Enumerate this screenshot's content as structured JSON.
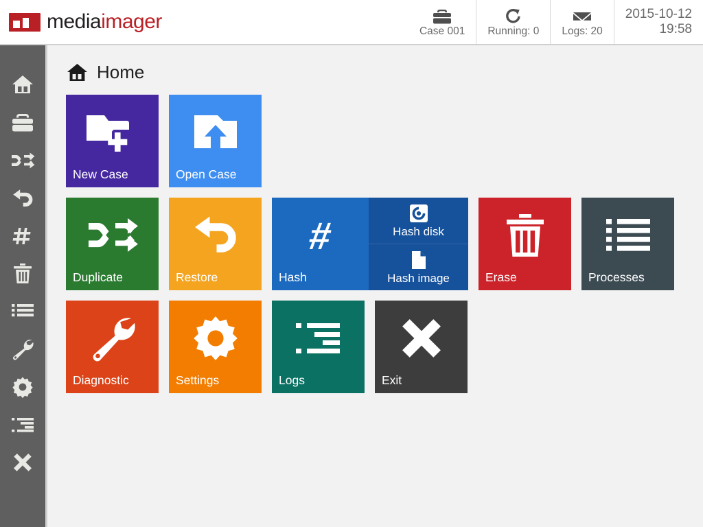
{
  "header": {
    "brand_a": "media",
    "brand_b": "imager",
    "logo_icon": "mediaimager-logo-mark",
    "status": [
      {
        "icon": "briefcase-icon",
        "label": "Case 001"
      },
      {
        "icon": "refresh-rotate-icon",
        "label": "Running: 0"
      },
      {
        "icon": "envelope-icon",
        "label": "Logs: 20"
      }
    ],
    "date": "2015-10-12",
    "time": "19:58"
  },
  "sidebar": {
    "items": [
      {
        "icon": "home-icon",
        "name": "home"
      },
      {
        "icon": "briefcase-icon",
        "name": "case"
      },
      {
        "icon": "shuffle-icon",
        "name": "duplicate"
      },
      {
        "icon": "undo-icon",
        "name": "restore"
      },
      {
        "icon": "hash-icon",
        "name": "hash"
      },
      {
        "icon": "trash-icon",
        "name": "erase"
      },
      {
        "icon": "list-icon",
        "name": "processes"
      },
      {
        "icon": "wrench-icon",
        "name": "diagnostic"
      },
      {
        "icon": "gear-icon",
        "name": "settings"
      },
      {
        "icon": "indented-list-icon",
        "name": "logs"
      },
      {
        "icon": "close-x-icon",
        "name": "exit"
      }
    ]
  },
  "breadcrumb": {
    "icon": "home-icon",
    "title": "Home"
  },
  "tiles": {
    "row1": [
      {
        "label": "New Case",
        "icon": "folder-plus-icon",
        "color": "#4527a0"
      },
      {
        "label": "Open Case",
        "icon": "folder-up-arrow-icon",
        "color": "#3d8ef0"
      }
    ],
    "row2": [
      {
        "label": "Duplicate",
        "icon": "shuffle-icon",
        "color": "#2a7a30"
      },
      {
        "label": "Restore",
        "icon": "undo-icon",
        "color": "#f4a41f"
      }
    ],
    "hash": {
      "main_label": "Hash",
      "main_icon": "hash-icon",
      "main_color": "#1b6ac0",
      "sub_color": "#16519b",
      "subs": [
        {
          "label": "Hash disk",
          "icon": "disk-icon"
        },
        {
          "label": "Hash image",
          "icon": "document-icon"
        }
      ]
    },
    "row2b": [
      {
        "label": "Erase",
        "icon": "trash-icon",
        "color": "#cc2229"
      },
      {
        "label": "Processes",
        "icon": "list-icon",
        "color": "#3c4a52"
      }
    ],
    "row3": [
      {
        "label": "Diagnostic",
        "icon": "wrench-icon",
        "color": "#dc4318"
      },
      {
        "label": "Settings",
        "icon": "gear-icon",
        "color": "#f27d00"
      },
      {
        "label": "Logs",
        "icon": "indented-list-icon",
        "color": "#0a7163"
      },
      {
        "label": "Exit",
        "icon": "close-x-icon",
        "color": "#3d3d3d"
      }
    ]
  },
  "colors": {
    "sidebar_bg": "#5f5f5f",
    "content_bg": "#f2f2f2",
    "brand_red": "#b92025",
    "header_bg": "#ffffff"
  }
}
